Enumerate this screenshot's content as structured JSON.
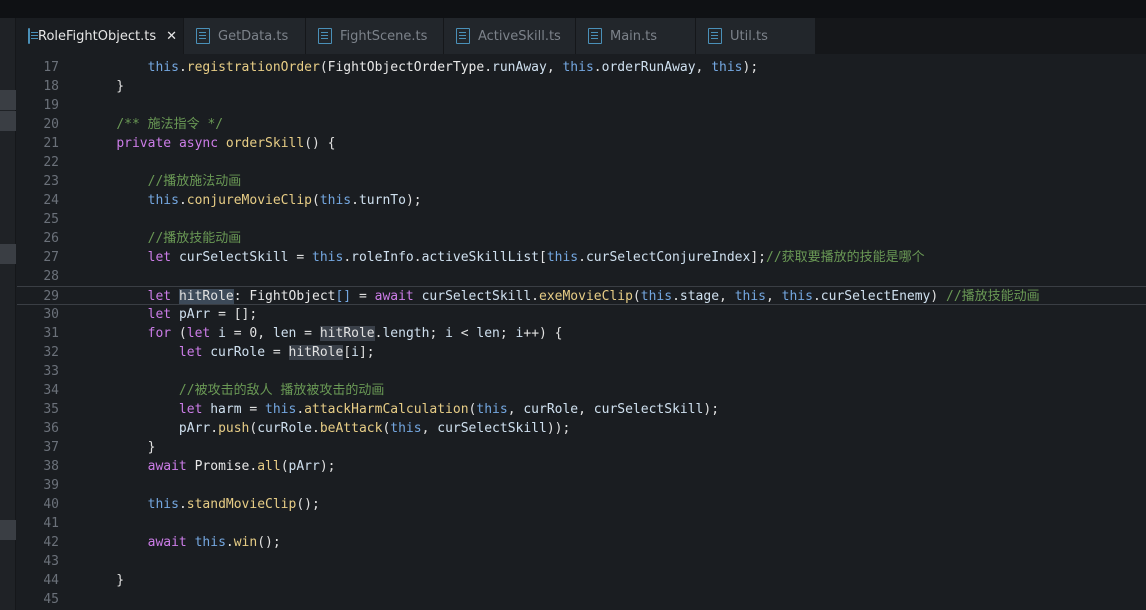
{
  "tabs": [
    {
      "label": "RoleFightObject.ts",
      "active": true,
      "close": "✕"
    },
    {
      "label": "GetData.ts",
      "active": false
    },
    {
      "label": "FightScene.ts",
      "active": false
    },
    {
      "label": "ActiveSkill.ts",
      "active": false
    },
    {
      "label": "Main.ts",
      "active": false
    },
    {
      "label": "Util.ts",
      "active": false
    }
  ],
  "editor": {
    "current_line": 29,
    "lines": [
      {
        "num": "17",
        "tokens": [
          [
            "pl",
            "        "
          ],
          [
            "th",
            "this"
          ],
          [
            "pl",
            "."
          ],
          [
            "fn",
            "registrationOrder"
          ],
          [
            "pl",
            "("
          ],
          [
            "ty",
            "FightObjectOrderType"
          ],
          [
            "pl",
            "."
          ],
          [
            "vr",
            "runAway"
          ],
          [
            "pl",
            ", "
          ],
          [
            "th",
            "this"
          ],
          [
            "pl",
            "."
          ],
          [
            "vr",
            "orderRunAway"
          ],
          [
            "pl",
            ", "
          ],
          [
            "th",
            "this"
          ],
          [
            "pl",
            ");"
          ]
        ]
      },
      {
        "num": "18",
        "tokens": [
          [
            "pl",
            "    }"
          ]
        ]
      },
      {
        "num": "19",
        "tokens": []
      },
      {
        "num": "20",
        "tokens": [
          [
            "pl",
            "    "
          ],
          [
            "cm",
            "/** 施法指令 */"
          ]
        ]
      },
      {
        "num": "21",
        "tokens": [
          [
            "pl",
            "    "
          ],
          [
            "kw",
            "private"
          ],
          [
            "pl",
            " "
          ],
          [
            "kw",
            "async"
          ],
          [
            "pl",
            " "
          ],
          [
            "fn",
            "orderSkill"
          ],
          [
            "pl",
            "() {"
          ]
        ]
      },
      {
        "num": "22",
        "tokens": []
      },
      {
        "num": "23",
        "tokens": [
          [
            "pl",
            "        "
          ],
          [
            "cm",
            "//播放施法动画"
          ]
        ]
      },
      {
        "num": "24",
        "tokens": [
          [
            "pl",
            "        "
          ],
          [
            "th",
            "this"
          ],
          [
            "pl",
            "."
          ],
          [
            "fn",
            "conjureMovieClip"
          ],
          [
            "pl",
            "("
          ],
          [
            "th",
            "this"
          ],
          [
            "pl",
            "."
          ],
          [
            "vr",
            "turnTo"
          ],
          [
            "pl",
            ");"
          ]
        ]
      },
      {
        "num": "25",
        "tokens": []
      },
      {
        "num": "26",
        "tokens": [
          [
            "pl",
            "        "
          ],
          [
            "cm",
            "//播放技能动画"
          ]
        ]
      },
      {
        "num": "27",
        "tokens": [
          [
            "pl",
            "        "
          ],
          [
            "kw",
            "let"
          ],
          [
            "pl",
            " "
          ],
          [
            "vr",
            "curSelectSkill"
          ],
          [
            "pl",
            " = "
          ],
          [
            "th",
            "this"
          ],
          [
            "pl",
            "."
          ],
          [
            "vr",
            "roleInfo"
          ],
          [
            "pl",
            "."
          ],
          [
            "vr",
            "activeSkillList"
          ],
          [
            "pl",
            "["
          ],
          [
            "th",
            "this"
          ],
          [
            "pl",
            "."
          ],
          [
            "vr",
            "curSelectConjureIndex"
          ],
          [
            "pl",
            "];"
          ],
          [
            "cm",
            "//获取要播放的技能是哪个"
          ]
        ]
      },
      {
        "num": "28",
        "tokens": []
      },
      {
        "num": "29",
        "tokens": [
          [
            "pl",
            "        "
          ],
          [
            "kw",
            "let"
          ],
          [
            "pl",
            " "
          ],
          [
            "hl",
            "hitRole"
          ],
          [
            "pl",
            ": "
          ],
          [
            "ty",
            "FightObject"
          ],
          [
            "th",
            "[]"
          ],
          [
            "pl",
            " = "
          ],
          [
            "kw",
            "await"
          ],
          [
            "pl",
            " "
          ],
          [
            "vr",
            "curSelectSkill"
          ],
          [
            "pl",
            "."
          ],
          [
            "fn",
            "exeMovieClip"
          ],
          [
            "pl",
            "("
          ],
          [
            "th",
            "this"
          ],
          [
            "pl",
            "."
          ],
          [
            "vr",
            "stage"
          ],
          [
            "pl",
            ", "
          ],
          [
            "th",
            "this"
          ],
          [
            "pl",
            ", "
          ],
          [
            "th",
            "this"
          ],
          [
            "pl",
            "."
          ],
          [
            "vr",
            "curSelectEnemy"
          ],
          [
            "pl",
            ") "
          ],
          [
            "cm",
            "//播放技能动画"
          ]
        ]
      },
      {
        "num": "30",
        "tokens": [
          [
            "pl",
            "        "
          ],
          [
            "kw",
            "let"
          ],
          [
            "pl",
            " "
          ],
          [
            "vr",
            "pArr"
          ],
          [
            "pl",
            " = [];"
          ]
        ]
      },
      {
        "num": "31",
        "tokens": [
          [
            "pl",
            "        "
          ],
          [
            "kw",
            "for"
          ],
          [
            "pl",
            " ("
          ],
          [
            "kw",
            "let"
          ],
          [
            "pl",
            " "
          ],
          [
            "vr",
            "i"
          ],
          [
            "pl",
            " = "
          ],
          [
            "pl",
            "0"
          ],
          [
            "pl",
            ", "
          ],
          [
            "vr",
            "len"
          ],
          [
            "pl",
            " = "
          ],
          [
            "hl2",
            "hitRole"
          ],
          [
            "pl",
            "."
          ],
          [
            "vr",
            "length"
          ],
          [
            "pl",
            "; "
          ],
          [
            "vr",
            "i"
          ],
          [
            "pl",
            " < "
          ],
          [
            "vr",
            "len"
          ],
          [
            "pl",
            "; "
          ],
          [
            "vr",
            "i"
          ],
          [
            "pl",
            "++) {"
          ]
        ]
      },
      {
        "num": "32",
        "tokens": [
          [
            "pl",
            "            "
          ],
          [
            "kw",
            "let"
          ],
          [
            "pl",
            " "
          ],
          [
            "vr",
            "curRole"
          ],
          [
            "pl",
            " = "
          ],
          [
            "hl2",
            "hitRole"
          ],
          [
            "pl",
            "["
          ],
          [
            "vr",
            "i"
          ],
          [
            "pl",
            "];"
          ]
        ]
      },
      {
        "num": "33",
        "tokens": []
      },
      {
        "num": "34",
        "tokens": [
          [
            "pl",
            "            "
          ],
          [
            "cm",
            "//被攻击的敌人 播放被攻击的动画"
          ]
        ]
      },
      {
        "num": "35",
        "tokens": [
          [
            "pl",
            "            "
          ],
          [
            "kw",
            "let"
          ],
          [
            "pl",
            " "
          ],
          [
            "vr",
            "harm"
          ],
          [
            "pl",
            " = "
          ],
          [
            "th",
            "this"
          ],
          [
            "pl",
            "."
          ],
          [
            "fn",
            "attackHarmCalculation"
          ],
          [
            "pl",
            "("
          ],
          [
            "th",
            "this"
          ],
          [
            "pl",
            ", "
          ],
          [
            "vr",
            "curRole"
          ],
          [
            "pl",
            ", "
          ],
          [
            "vr",
            "curSelectSkill"
          ],
          [
            "pl",
            ");"
          ]
        ]
      },
      {
        "num": "36",
        "tokens": [
          [
            "pl",
            "            "
          ],
          [
            "vr",
            "pArr"
          ],
          [
            "pl",
            "."
          ],
          [
            "fn",
            "push"
          ],
          [
            "pl",
            "("
          ],
          [
            "vr",
            "curRole"
          ],
          [
            "pl",
            "."
          ],
          [
            "fn",
            "beAttack"
          ],
          [
            "pl",
            "("
          ],
          [
            "th",
            "this"
          ],
          [
            "pl",
            ", "
          ],
          [
            "vr",
            "curSelectSkill"
          ],
          [
            "pl",
            "));"
          ]
        ]
      },
      {
        "num": "37",
        "tokens": [
          [
            "pl",
            "        }"
          ]
        ]
      },
      {
        "num": "38",
        "tokens": [
          [
            "pl",
            "        "
          ],
          [
            "kw",
            "await"
          ],
          [
            "pl",
            " "
          ],
          [
            "ty",
            "Promise"
          ],
          [
            "pl",
            "."
          ],
          [
            "fn",
            "all"
          ],
          [
            "pl",
            "("
          ],
          [
            "vr",
            "pArr"
          ],
          [
            "pl",
            ");"
          ]
        ]
      },
      {
        "num": "39",
        "tokens": []
      },
      {
        "num": "40",
        "tokens": [
          [
            "pl",
            "        "
          ],
          [
            "th",
            "this"
          ],
          [
            "pl",
            "."
          ],
          [
            "fn",
            "standMovieClip"
          ],
          [
            "pl",
            "();"
          ]
        ]
      },
      {
        "num": "41",
        "tokens": []
      },
      {
        "num": "42",
        "tokens": [
          [
            "pl",
            "        "
          ],
          [
            "kw",
            "await"
          ],
          [
            "pl",
            " "
          ],
          [
            "th",
            "this"
          ],
          [
            "pl",
            "."
          ],
          [
            "fn",
            "win"
          ],
          [
            "pl",
            "();"
          ]
        ]
      },
      {
        "num": "43",
        "tokens": []
      },
      {
        "num": "44",
        "tokens": [
          [
            "pl",
            "    }"
          ]
        ]
      },
      {
        "num": "45",
        "tokens": []
      }
    ]
  }
}
